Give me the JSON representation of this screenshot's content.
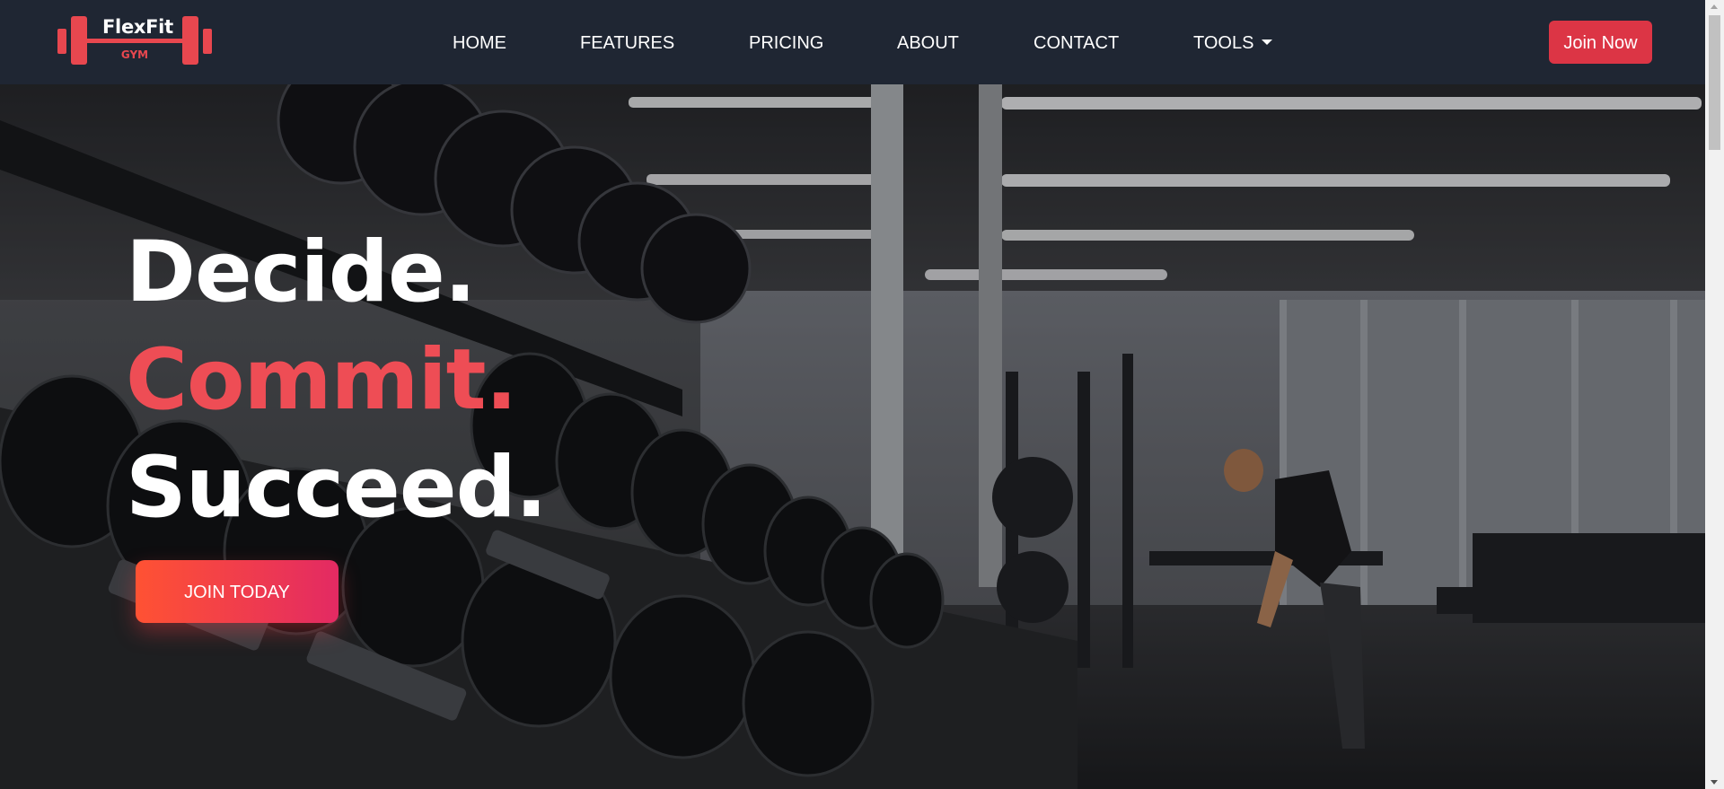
{
  "brand": {
    "name": "FlexFit",
    "sub": "GYM",
    "logo_icon": "barbell-icon",
    "accent_color": "#e8474f"
  },
  "nav": {
    "items": [
      {
        "label": "HOME"
      },
      {
        "label": "FEATURES"
      },
      {
        "label": "PRICING"
      },
      {
        "label": "ABOUT"
      },
      {
        "label": "CONTACT"
      },
      {
        "label": "TOOLS",
        "has_dropdown": true,
        "icon": "caret-down-icon"
      }
    ],
    "cta_label": "Join Now",
    "cta_color": "#dc3545",
    "background": "#1f2633"
  },
  "hero": {
    "line1": "Decide.",
    "line2": "Commit.",
    "line3": "Succeed.",
    "line2_color": "#ee4d55",
    "cta_label": "JOIN TODAY",
    "cta_gradient": [
      "#ff5233",
      "#e32a63"
    ],
    "background_image": "gym-dumbbell-rack-photo"
  }
}
